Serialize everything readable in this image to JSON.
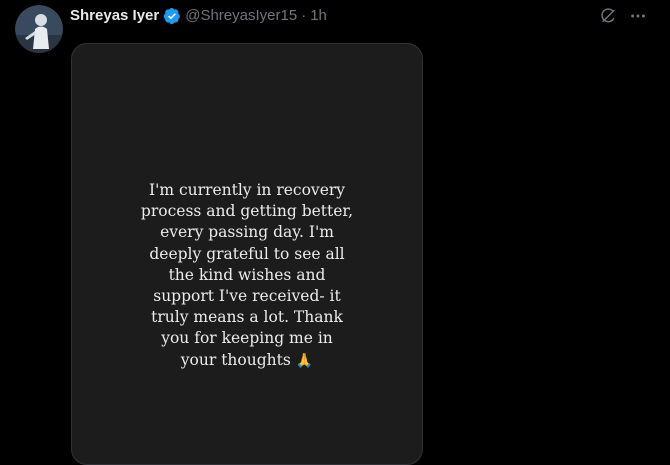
{
  "tweet": {
    "author_name": "Shreyas Iyer",
    "author_handle": "@ShreyasIyer15",
    "separator": "·",
    "timestamp": "1h",
    "verified": true,
    "accent_color": "#1d9bf0"
  },
  "icons": {
    "grok": "grok-icon",
    "more": "more-options-icon"
  },
  "media": {
    "story_lines": [
      "I'm currently in recovery",
      "process and getting better,",
      "every passing day. I'm",
      "deeply grateful to see all",
      "the kind wishes and",
      "support I've received- it",
      "truly means a lot. Thank",
      "you for keeping me in",
      "your thoughts"
    ],
    "emoji": "🙏"
  }
}
